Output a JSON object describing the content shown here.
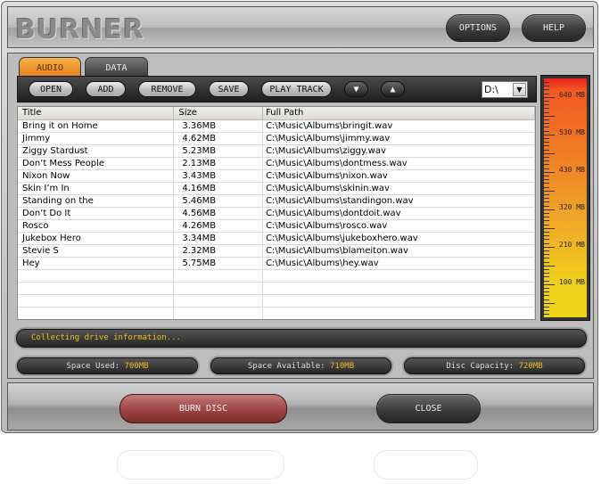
{
  "app": {
    "title": "BURNER"
  },
  "header": {
    "options_label": "OPTIONS",
    "help_label": "HELP"
  },
  "tabs": [
    {
      "label": "AUDIO",
      "active": true
    },
    {
      "label": "DATA",
      "active": false
    }
  ],
  "toolbar": {
    "open": "OPEN",
    "add": "ADD",
    "remove": "REMOVE",
    "save": "SAVE",
    "play_track": "PLAY TRACK",
    "move_down_icon": "▼",
    "move_up_icon": "▲",
    "drive_value": "D:\\",
    "drive_arrow": "▼"
  },
  "table": {
    "columns": [
      "Title",
      "Size",
      "Full Path"
    ],
    "rows": [
      [
        "Bring it on Home",
        "3.36MB",
        "C:\\Music\\Albums\\bringit.wav"
      ],
      [
        "Jimmy",
        "4.62MB",
        "C:\\Music\\Albums\\jimmy.wav"
      ],
      [
        "Ziggy Stardust",
        "5.23MB",
        "C:\\Music\\Albums\\ziggy.wav"
      ],
      [
        "Don’t Mess People",
        "2.13MB",
        "C:\\Music\\Albums\\dontmess.wav"
      ],
      [
        "Nixon Now",
        "3.43MB",
        "C:\\Music\\Albums\\nixon.wav"
      ],
      [
        "Skin I’m In",
        "4.16MB",
        "C:\\Music\\Albums\\skinin.wav"
      ],
      [
        "Standing on the",
        "5.46MB",
        "C:\\Music\\Albums\\standingon.wav"
      ],
      [
        "Don’t Do It",
        "4.56MB",
        "C:\\Music\\Albums\\dontdoit.wav"
      ],
      [
        "Rosco",
        "4.26MB",
        "C:\\Music\\Albums\\rosco.wav"
      ],
      [
        "Jukebox Hero",
        "3.34MB",
        "C:\\Music\\Albums\\jukeboxhero.wav"
      ],
      [
        "Stevie S",
        "2.32MB",
        "C:\\Music\\Albums\\blameiton.wav"
      ],
      [
        "Hey",
        "5.75MB",
        "C:\\Music\\Albums\\hey.wav"
      ]
    ],
    "empty_rows": 4
  },
  "meter": {
    "labels": [
      "640 MB",
      "530 MB",
      "430 MB",
      "320 MB",
      "210 MB",
      "100 MB"
    ],
    "colors": {
      "top": "#ec2020",
      "bottom": "#f0d418"
    }
  },
  "status": {
    "message": "Collecting drive information..."
  },
  "info": {
    "space_used_label": "Space Used: ",
    "space_used_value": "700MB",
    "space_available_label": "Space Available: ",
    "space_available_value": "710MB",
    "disc_capacity_label": "Disc Capacity: ",
    "disc_capacity_value": "720MB"
  },
  "footer": {
    "burn_label": "BURN DISC",
    "close_label": "CLOSE"
  },
  "colors": {
    "accent_orange": "#e8891f",
    "status_yellow": "#f0c020",
    "burn_red": "#a04848"
  }
}
